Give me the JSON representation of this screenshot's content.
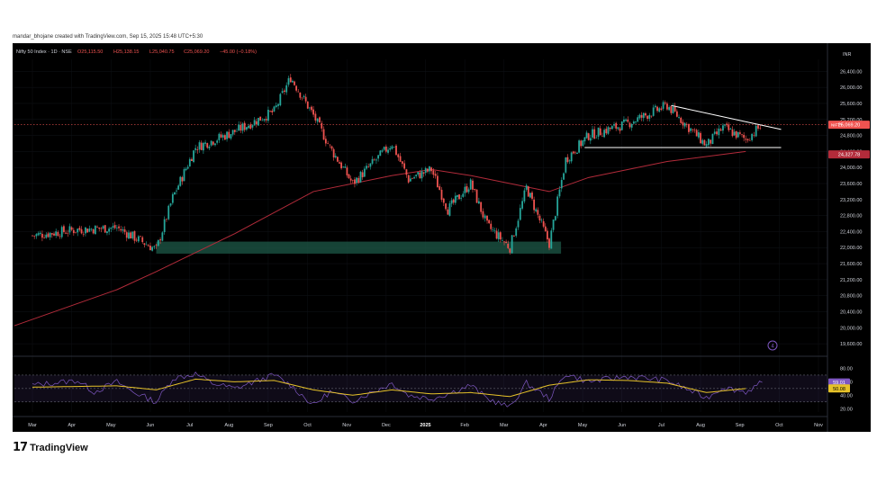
{
  "caption": "mandar_bhojane created with TradingView.com, Sep 15, 2025 15:48 UTC+5:30",
  "legend": {
    "symbol": "Nifty 50 Index · 1D · NSE",
    "o": "O25,115.50",
    "h": "H25,138.15",
    "l": "L25,040.75",
    "c": "C25,069.20",
    "chg": "−45.00 (−0.18%)"
  },
  "logo": {
    "text": "TradingView"
  },
  "colors": {
    "up": "#26a69a",
    "down": "#ef5350",
    "ma": "#b22b3a",
    "zone": "#1d5a48",
    "trendline": "#ffffff",
    "rsi": "#7e57c2",
    "rsi_ma": "#e6c229"
  },
  "chart_data": [
    {
      "type": "candlestick",
      "title": "",
      "currency_label": "INR",
      "ylim": [
        19400,
        26700
      ],
      "price_ticks": [
        "26,400.00",
        "26,000.00",
        "25,600.00",
        "25,200.00",
        "24,800.00",
        "24,400.00",
        "24,000.00",
        "23,600.00",
        "23,200.00",
        "22,800.00",
        "22,400.00",
        "22,000.00",
        "21,600.00",
        "21,200.00",
        "20,800.00",
        "20,400.00",
        "20,000.00",
        "19,600.00"
      ],
      "x_labels": [
        "Mar",
        "Apr",
        "May",
        "Jun",
        "Jul",
        "Aug",
        "Sep",
        "Oct",
        "Nov",
        "Dec",
        "2025",
        "Feb",
        "Mar",
        "Apr",
        "May",
        "Jun",
        "Jul",
        "Aug",
        "Sep",
        "Oct",
        "Nov"
      ],
      "last_price": {
        "label": "NIFTY",
        "value": "25,069.20"
      },
      "ma_value": "24,327.78",
      "key_points": [
        {
          "x": "Mar 2024",
          "close": 22300
        },
        {
          "x": "Apr 2024",
          "close": 22450
        },
        {
          "x": "May 2024",
          "close": 22500
        },
        {
          "x": "Jun 2024",
          "close": 21950
        },
        {
          "x": "Jun 2024",
          "close": 23250
        },
        {
          "x": "Jul 2024",
          "close": 24500
        },
        {
          "x": "Aug 2024",
          "close": 24900
        },
        {
          "x": "Sep 2024",
          "close": 25400
        },
        {
          "x": "Sep 2024",
          "close": 26250
        },
        {
          "x": "Oct 2024",
          "close": 25300
        },
        {
          "x": "Oct 2024",
          "close": 24500
        },
        {
          "x": "Nov 2024",
          "close": 23600
        },
        {
          "x": "Dec 2024",
          "close": 24600
        },
        {
          "x": "Dec 2024",
          "close": 23700
        },
        {
          "x": "2025",
          "close": 23950
        },
        {
          "x": "Jan 2025",
          "close": 22950
        },
        {
          "x": "Feb 2025",
          "close": 23600
        },
        {
          "x": "Feb 2025",
          "close": 22550
        },
        {
          "x": "Mar 2025",
          "close": 22000
        },
        {
          "x": "Mar 2025",
          "close": 23500
        },
        {
          "x": "Apr 2025",
          "close": 22100
        },
        {
          "x": "Apr 2025",
          "close": 24200
        },
        {
          "x": "May 2025",
          "close": 24800
        },
        {
          "x": "Jun 2025",
          "close": 25100
        },
        {
          "x": "Jul 2025",
          "close": 25550
        },
        {
          "x": "Aug 2025",
          "close": 24550
        },
        {
          "x": "Aug 2025",
          "close": 25000
        },
        {
          "x": "Sep 2025",
          "close": 24700
        },
        {
          "x": "Sep 2025",
          "close": 25069
        }
      ],
      "moving_average": [
        {
          "x": "Mar 2024",
          "value": 20050
        },
        {
          "x": "May 2024",
          "value": 20950
        },
        {
          "x": "Jun 2024",
          "value": 21400
        },
        {
          "x": "Aug 2024",
          "value": 22350
        },
        {
          "x": "Oct 2024",
          "value": 23400
        },
        {
          "x": "Dec 2024",
          "value": 23800
        },
        {
          "x": "2025",
          "value": 23950
        },
        {
          "x": "Feb 2025",
          "value": 23800
        },
        {
          "x": "Apr 2025",
          "value": 23400
        },
        {
          "x": "May 2025",
          "value": 23750
        },
        {
          "x": "Jul 2025",
          "value": 24150
        },
        {
          "x": "Sep 2025",
          "value": 24400
        }
      ],
      "demand_zone": {
        "from": "Jun 2024",
        "to": "Apr 2025",
        "low": 21850,
        "high": 22150
      },
      "resistance_line": {
        "from": {
          "x": "Jul 2025",
          "y": 25550
        },
        "to": {
          "x": "Sep 2025",
          "y": 24950
        }
      },
      "support_line": {
        "from": {
          "x": "May 2025",
          "y": 24500
        },
        "to": {
          "x": "Sep 2025",
          "y": 24500
        }
      }
    },
    {
      "type": "line",
      "title": "",
      "ylim": [
        15,
        90
      ],
      "rsi_ticks": [
        "80.00",
        "60.00",
        "40.00",
        "20.00"
      ],
      "bands": [
        70,
        50,
        30
      ],
      "rsi_value": "59.01",
      "rsi_ma_value": "50.08",
      "series": [
        {
          "name": "",
          "points": [
            {
              "x": "Mar 2024",
              "y": 55
            },
            {
              "x": "Apr 2024",
              "y": 62
            },
            {
              "x": "Apr 2024",
              "y": 45
            },
            {
              "x": "May 2024",
              "y": 60
            },
            {
              "x": "May 2024",
              "y": 45
            },
            {
              "x": "Jun 2024",
              "y": 30
            },
            {
              "x": "Jun 2024",
              "y": 65
            },
            {
              "x": "Jul 2024",
              "y": 72
            },
            {
              "x": "Jul 2024",
              "y": 58
            },
            {
              "x": "Aug 2024",
              "y": 50
            },
            {
              "x": "Sep 2024",
              "y": 70
            },
            {
              "x": "Sep 2024",
              "y": 55
            },
            {
              "x": "Oct 2024",
              "y": 25
            },
            {
              "x": "Oct 2024",
              "y": 45
            },
            {
              "x": "Nov 2024",
              "y": 32
            },
            {
              "x": "Dec 2024",
              "y": 58
            },
            {
              "x": "Dec 2024",
              "y": 40
            },
            {
              "x": "2025",
              "y": 35
            },
            {
              "x": "Jan 2025",
              "y": 42
            },
            {
              "x": "Feb 2025",
              "y": 55
            },
            {
              "x": "Feb 2025",
              "y": 35
            },
            {
              "x": "Mar 2025",
              "y": 22
            },
            {
              "x": "Mar 2025",
              "y": 58
            },
            {
              "x": "Apr 2025",
              "y": 35
            },
            {
              "x": "Apr 2025",
              "y": 72
            },
            {
              "x": "May 2025",
              "y": 60
            },
            {
              "x": "Jun 2025",
              "y": 68
            },
            {
              "x": "Jul 2025",
              "y": 62
            },
            {
              "x": "Aug 2025",
              "y": 36
            },
            {
              "x": "Aug 2025",
              "y": 52
            },
            {
              "x": "Sep 2025",
              "y": 45
            },
            {
              "x": "Sep 2025",
              "y": 59
            }
          ]
        },
        {
          "name": "",
          "points": [
            {
              "x": "Mar 2024",
              "y": 52
            },
            {
              "x": "May 2024",
              "y": 54
            },
            {
              "x": "Jun 2024",
              "y": 48
            },
            {
              "x": "Jul 2024",
              "y": 64
            },
            {
              "x": "Aug 2024",
              "y": 60
            },
            {
              "x": "Sep 2024",
              "y": 62
            },
            {
              "x": "Oct 2024",
              "y": 48
            },
            {
              "x": "Nov 2024",
              "y": 40
            },
            {
              "x": "Dec 2024",
              "y": 48
            },
            {
              "x": "2025",
              "y": 42
            },
            {
              "x": "Feb 2025",
              "y": 44
            },
            {
              "x": "Mar 2025",
              "y": 38
            },
            {
              "x": "Apr 2025",
              "y": 55
            },
            {
              "x": "May 2025",
              "y": 63
            },
            {
              "x": "Jun 2025",
              "y": 62
            },
            {
              "x": "Jul 2025",
              "y": 58
            },
            {
              "x": "Aug 2025",
              "y": 44
            },
            {
              "x": "Sep 2025",
              "y": 50
            }
          ]
        }
      ]
    }
  ]
}
